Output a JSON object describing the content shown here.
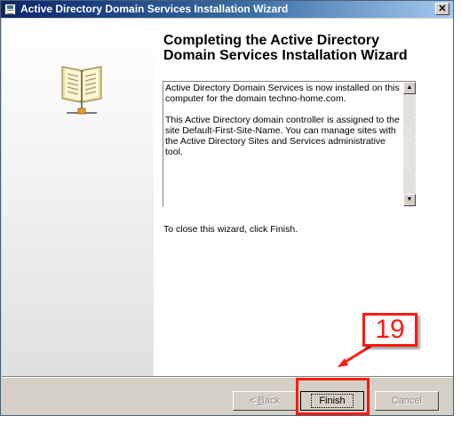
{
  "window": {
    "title": "Active Directory Domain Services Installation Wizard",
    "close_glyph": "✕"
  },
  "main": {
    "heading": "Completing the Active Directory Domain Services Installation Wizard",
    "info_paragraphs": [
      "Active Directory Domain Services is now installed on this computer for the domain techno-home.com.",
      "This Active Directory domain controller is assigned to the site Default-First-Site-Name. You can manage sites with the Active Directory Sites and Services administrative tool."
    ],
    "close_instruction": "To close this wizard, click Finish."
  },
  "footer": {
    "back_prefix": "< ",
    "back_accel": "B",
    "back_rest": "ack",
    "finish_label": "Finish",
    "cancel_label": "Cancel"
  },
  "annotation": {
    "step_number": "19",
    "color": "#ff1a0f"
  }
}
